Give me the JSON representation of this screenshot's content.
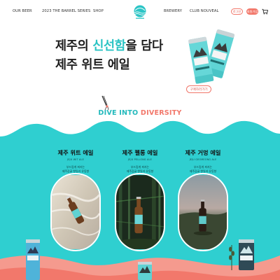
{
  "header": {
    "nav_left": [
      "OUR BEER",
      "2023 THE BARREL SERIES",
      "SHOP"
    ],
    "nav_right": [
      "BREWERY",
      "CLUB NOUVEAL"
    ],
    "login_label": "로그인",
    "join_label": "회원가입",
    "logo_icon": "jeju-brewery-logo-icon",
    "cart_icon": "cart-icon"
  },
  "hero": {
    "line1_prefix": "제주의 ",
    "line1_highlight": "신선함",
    "line1_suffix": "을 담다",
    "line2": "제주 위트 에일",
    "buy_label": "구매하러가기",
    "highlight_color": "#29c3c3"
  },
  "section": {
    "title_part1": "DIVE INTO",
    "title_part2": "DIVERSITY",
    "color_part1": "#23b9bc",
    "color_part2": "#f2786b",
    "band_color": "#2fcfd0"
  },
  "beers": [
    {
      "name": "제주 위트 에일",
      "subtitle": "JEJU WIT ALE",
      "desc_line1": "부드럽게 퍼지는",
      "desc_line2": "제주감귤 향일과 유동향"
    },
    {
      "name": "제주 펠롱 에일",
      "subtitle": "JEJU PELLONG ALE",
      "desc_line1": "부드럽게 퍼지는",
      "desc_line2": "제주감귤 향일과 유동향"
    },
    {
      "name": "제주 거멍 에일",
      "subtitle": "JEJU GEOMEONG ALE",
      "desc_line1": "부드럽게 퍼지는",
      "desc_line2": "제주감귤 향일과 유동향"
    }
  ]
}
